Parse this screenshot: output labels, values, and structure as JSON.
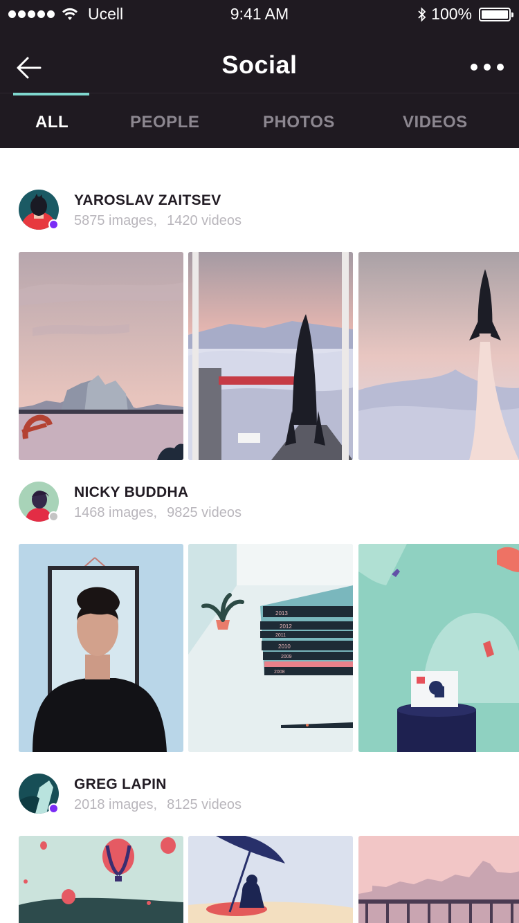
{
  "status_bar": {
    "carrier": "Ucell",
    "time": "9:41 AM",
    "battery": "100%"
  },
  "nav": {
    "title": "Social",
    "back_icon": "arrow-left-icon",
    "more_icon": "more-horizontal-icon"
  },
  "tabs": [
    {
      "label": "ALL",
      "active": true
    },
    {
      "label": "PEOPLE",
      "active": false
    },
    {
      "label": "PHOTOS",
      "active": false
    },
    {
      "label": "VIDEOS",
      "active": false
    }
  ],
  "colors": {
    "header_bg": "#1f1a21",
    "tab_indicator": "#7fd8cf",
    "presence_online": "#7a2cf5",
    "presence_offline": "#c4c4c4"
  },
  "feed": [
    {
      "name": "YAROSLAV ZAITSEV",
      "images": "5875 images,",
      "videos": "1420 videos",
      "status": "online"
    },
    {
      "name": "NICKY BUDDHA",
      "images": "1468 images,",
      "videos": "9825 videos",
      "status": "offline"
    },
    {
      "name": "GREG LAPIN",
      "images": "2018 images,",
      "videos": "8125 videos",
      "status": "online"
    }
  ],
  "illustration_labels": {
    "book_years": [
      "2013",
      "2012",
      "2011",
      "2010",
      "2009",
      "2008"
    ]
  }
}
